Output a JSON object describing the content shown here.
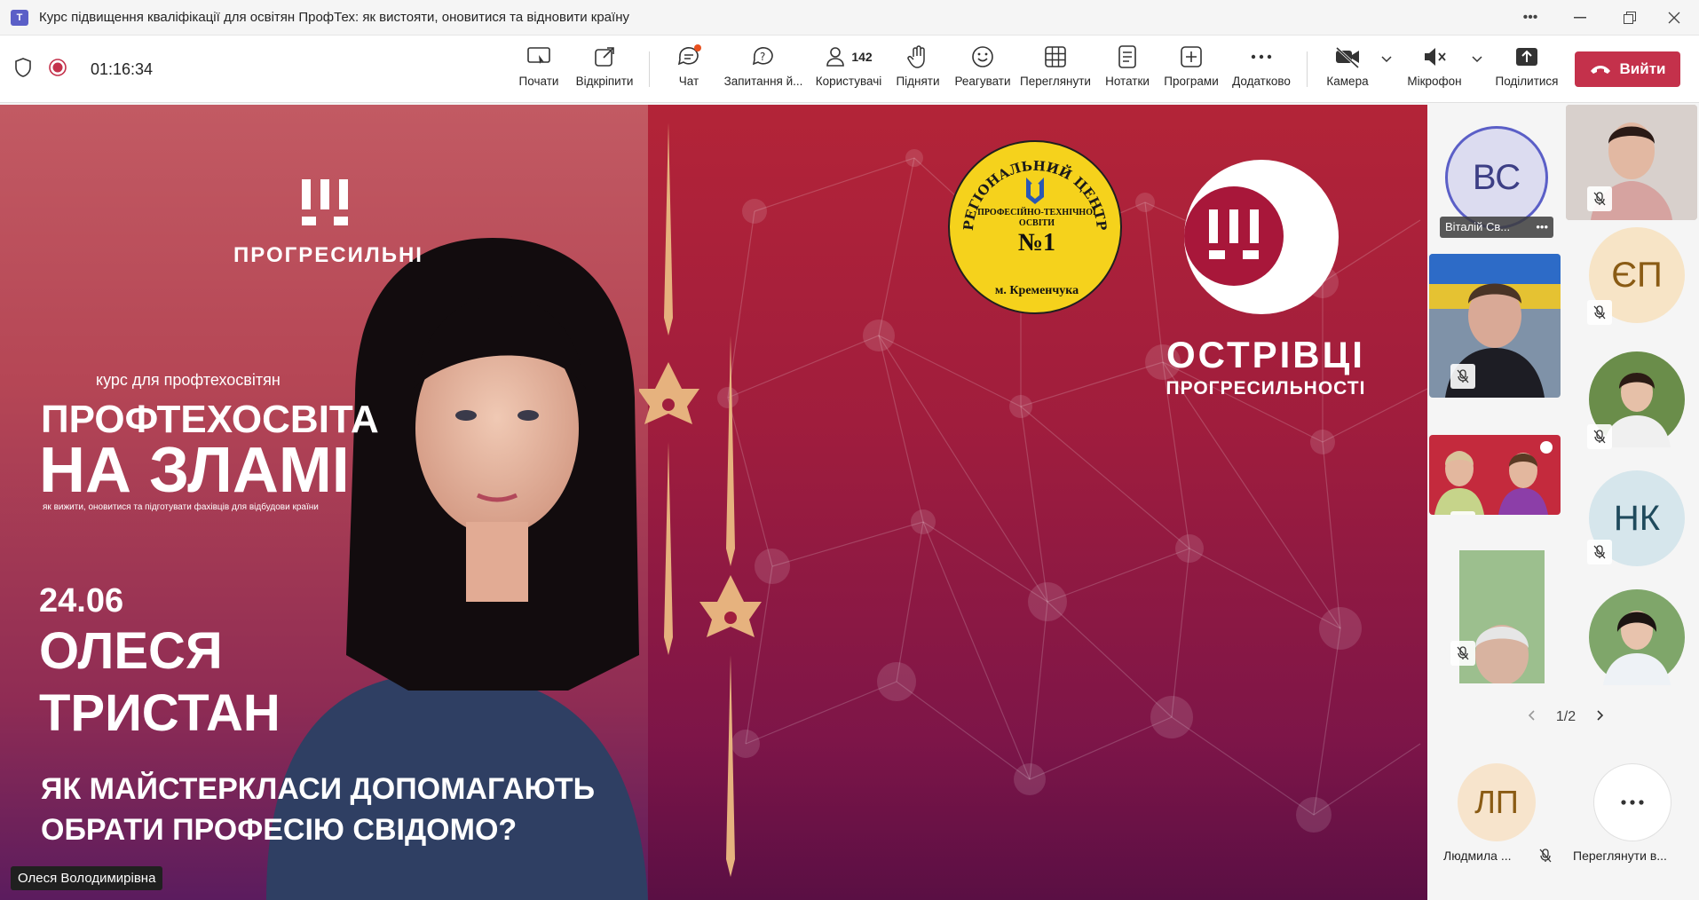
{
  "window": {
    "title": "Курс підвищення кваліфікації для освітян ПрофТех: як вистояти, оновитися та відновити країну",
    "app_icon": "teams-icon"
  },
  "meeting": {
    "timer": "01:16:34",
    "participants_count": "142"
  },
  "toolbar": {
    "start_label": "Почати",
    "popout_label": "Відкріпити",
    "chat_label": "Чат",
    "qa_label": "Запитання й...",
    "people_label": "Користувачі",
    "raise_label": "Підняти",
    "react_label": "Реагувати",
    "view_label": "Переглянути",
    "notes_label": "Нотатки",
    "apps_label": "Програми",
    "more_label": "Додатково",
    "camera_label": "Камера",
    "mic_label": "Мікрофон",
    "share_label": "Поділитися",
    "leave_label": "Вийти"
  },
  "slide": {
    "brand": "ПРОГРЕСИЛЬНІ",
    "course_for": "курс для профтехосвітян",
    "headline_1": "ПРОФТЕХОСВІТА",
    "headline_2": "НА ЗЛАМІ",
    "subline": "як вижити, оновитися та підготувати фахівців для відбудови країни",
    "date": "24.06",
    "speaker_1": "ОЛЕСЯ",
    "speaker_2": "ТРИСТАН",
    "topic_1": "ЯК МАЙСТЕРКЛАСИ ДОПОМАГАЮТЬ",
    "topic_2": "ОБРАТИ ПРОФЕСІЮ СВІДОМО?",
    "seal_top": "РЕГІОНАЛЬНИЙ ЦЕНТР",
    "seal_mid_1": "ПРОФЕСІЙНО-ТЕХНІЧНОЇ",
    "seal_mid_2": "ОСВІТИ",
    "seal_num": "№1",
    "seal_city": "м. Кременчука",
    "islands_1": "ОСТРІВЦІ",
    "islands_2": "ПРОГРЕСИЛЬНОСТІ"
  },
  "presenter": {
    "name": "Олеся Володимирівна"
  },
  "participants": {
    "tile_vs_initials": "ВС",
    "tile_vs_name": "Віталій Св...",
    "tile_ep_initials": "ЄП",
    "tile_nk_initials": "НК",
    "tile_lp_initials": "ЛП",
    "tile_lp_name": "Людмила ...",
    "more_label": "Переглянути в...",
    "pagination": "1/2"
  },
  "colors": {
    "leave_red": "#c4314b",
    "teams_purple": "#5b5fc7",
    "slide_red": "#a01d3d"
  }
}
